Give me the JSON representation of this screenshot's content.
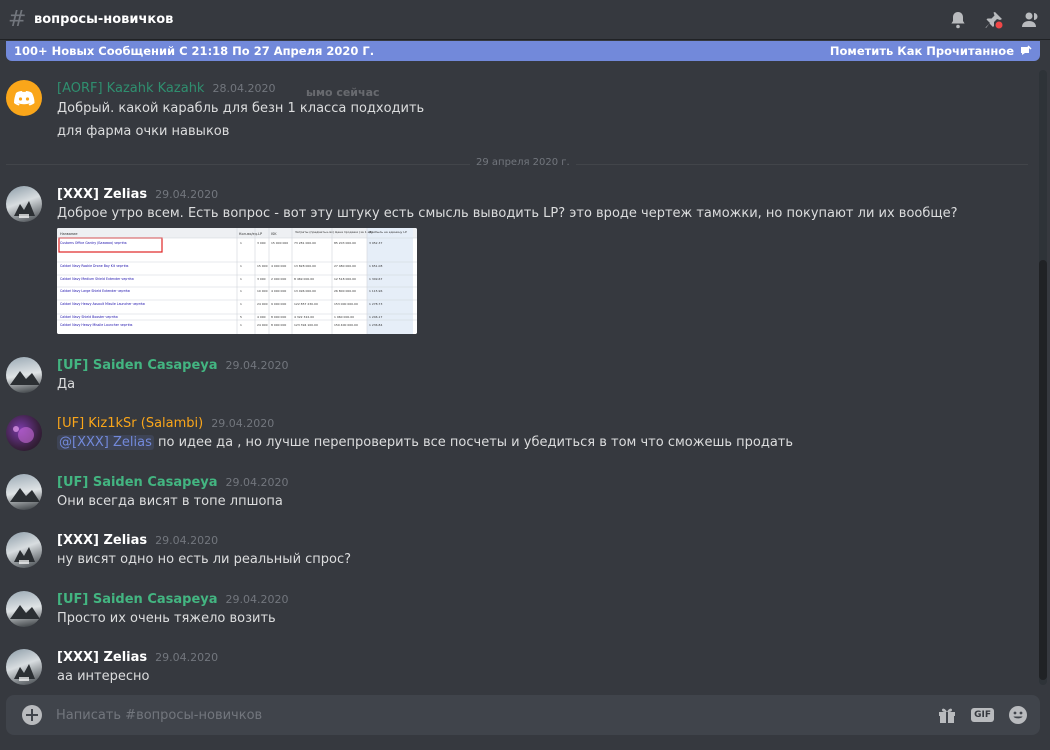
{
  "header": {
    "hash": "#",
    "channel_name": "вопросы-новичков"
  },
  "new_messages_bar": {
    "text": "100+ Новых Сообщений С 21:18 По 27 Апреля 2020 Г.",
    "ghost_text": "ымо сейчас",
    "mark_read": "Пометить Как Прочитанное"
  },
  "date_divider": "29 апреля 2020 г.",
  "messages": [
    {
      "author": "[AORF] Kazahk Kazahk",
      "author_color": "#2f8f6f",
      "timestamp": "28.04.2020",
      "lines": [
        "Добрый. какой карабль для безн 1 класса подходить",
        "для фарма очки навыков"
      ]
    },
    {
      "author": "[XXX] Zelias",
      "author_color": "#ffffff",
      "timestamp": "29.04.2020",
      "lines": [
        "Доброе утро всем. Есть вопрос - вот эту штуку есть смысль выводить LP? это вроде чертеж таможки, но покупают ли их вообще?"
      ]
    },
    {
      "author": "[UF] Saiden Casapeya",
      "author_color": "#43b581",
      "timestamp": "29.04.2020",
      "lines": [
        "Да"
      ]
    },
    {
      "author": "[UF] Kiz1kSr (Salambi)",
      "author_color": "#faa61a",
      "timestamp": "29.04.2020",
      "mention": "@[XXX] Zelias",
      "lines": [
        " по идее да , но лучше перепроверить все посчеты и убедиться в том что сможешь продать"
      ]
    },
    {
      "author": "[UF] Saiden Casapeya",
      "author_color": "#43b581",
      "timestamp": "29.04.2020",
      "lines": [
        "Они всегда висят в топе лпшопа"
      ]
    },
    {
      "author": "[XXX] Zelias",
      "author_color": "#ffffff",
      "timestamp": "29.04.2020",
      "lines": [
        "ну висят одно но есть ли реальный спрос?"
      ]
    },
    {
      "author": "[UF] Saiden Casapeya",
      "author_color": "#43b581",
      "timestamp": "29.04.2020",
      "lines": [
        "Просто их очень тяжело возить"
      ]
    },
    {
      "author": "[XXX] Zelias",
      "author_color": "#ffffff",
      "timestamp": "29.04.2020",
      "lines": [
        "аа интересно"
      ]
    }
  ],
  "attachment": {
    "header": [
      "Название",
      "Кол-во/ед.",
      "LP",
      "ISK",
      "Затраты (предметы+isk)",
      "Цена продажи (за 1 ед)",
      "Прибыль на единицу LP"
    ],
    "rows": [
      [
        "Customs Office Gantry (Базовая) чертёж",
        "1",
        "3 000",
        "15 000 000",
        "73 281 000.00",
        "85 203 000.00",
        "3 952.37"
      ],
      [
        "Caldari Navy Rookie Drone Bay Kit чертёж",
        "1",
        "15 000",
        "4 000 000",
        "13 828 000.00",
        "27 480 000.00",
        "1 651.08"
      ],
      [
        "Caldari Navy Medium Shield Extender чертёж",
        "1",
        "3 000",
        "2 000 000",
        "8 469 000.00",
        "12 518 000.00",
        "1 349.67"
      ],
      [
        "Caldari Navy Large Shield Extender чертёж",
        "1",
        "10 000",
        "4 000 000",
        "13 496 000.00",
        "26 800 000.00",
        "1 115.96"
      ],
      [
        "Caldari Navy Heavy Assault Missile Launcher чертёж",
        "1",
        "24 000",
        "9 000 000",
        "122 857 230.00",
        "153 000 000.00",
        "1 278.73"
      ],
      [
        "Caldari Navy Shield Booster чертёж",
        "5",
        "4 000",
        "8 000 000",
        "4 322 322.00",
        "1 960 000.00",
        "1 246.17"
      ],
      [
        "Caldari Navy Heavy Missile Launcher чертёж",
        "1",
        "24 000",
        "8 000 000",
        "123 394 100.00",
        "150 400 000.00",
        "1 236.84"
      ]
    ]
  },
  "composer": {
    "placeholder": "Написать #вопросы-новичков",
    "gif_label": "GIF"
  },
  "colors": {
    "background": "#36393f",
    "accent": "#7289da",
    "composer": "#40444b"
  }
}
